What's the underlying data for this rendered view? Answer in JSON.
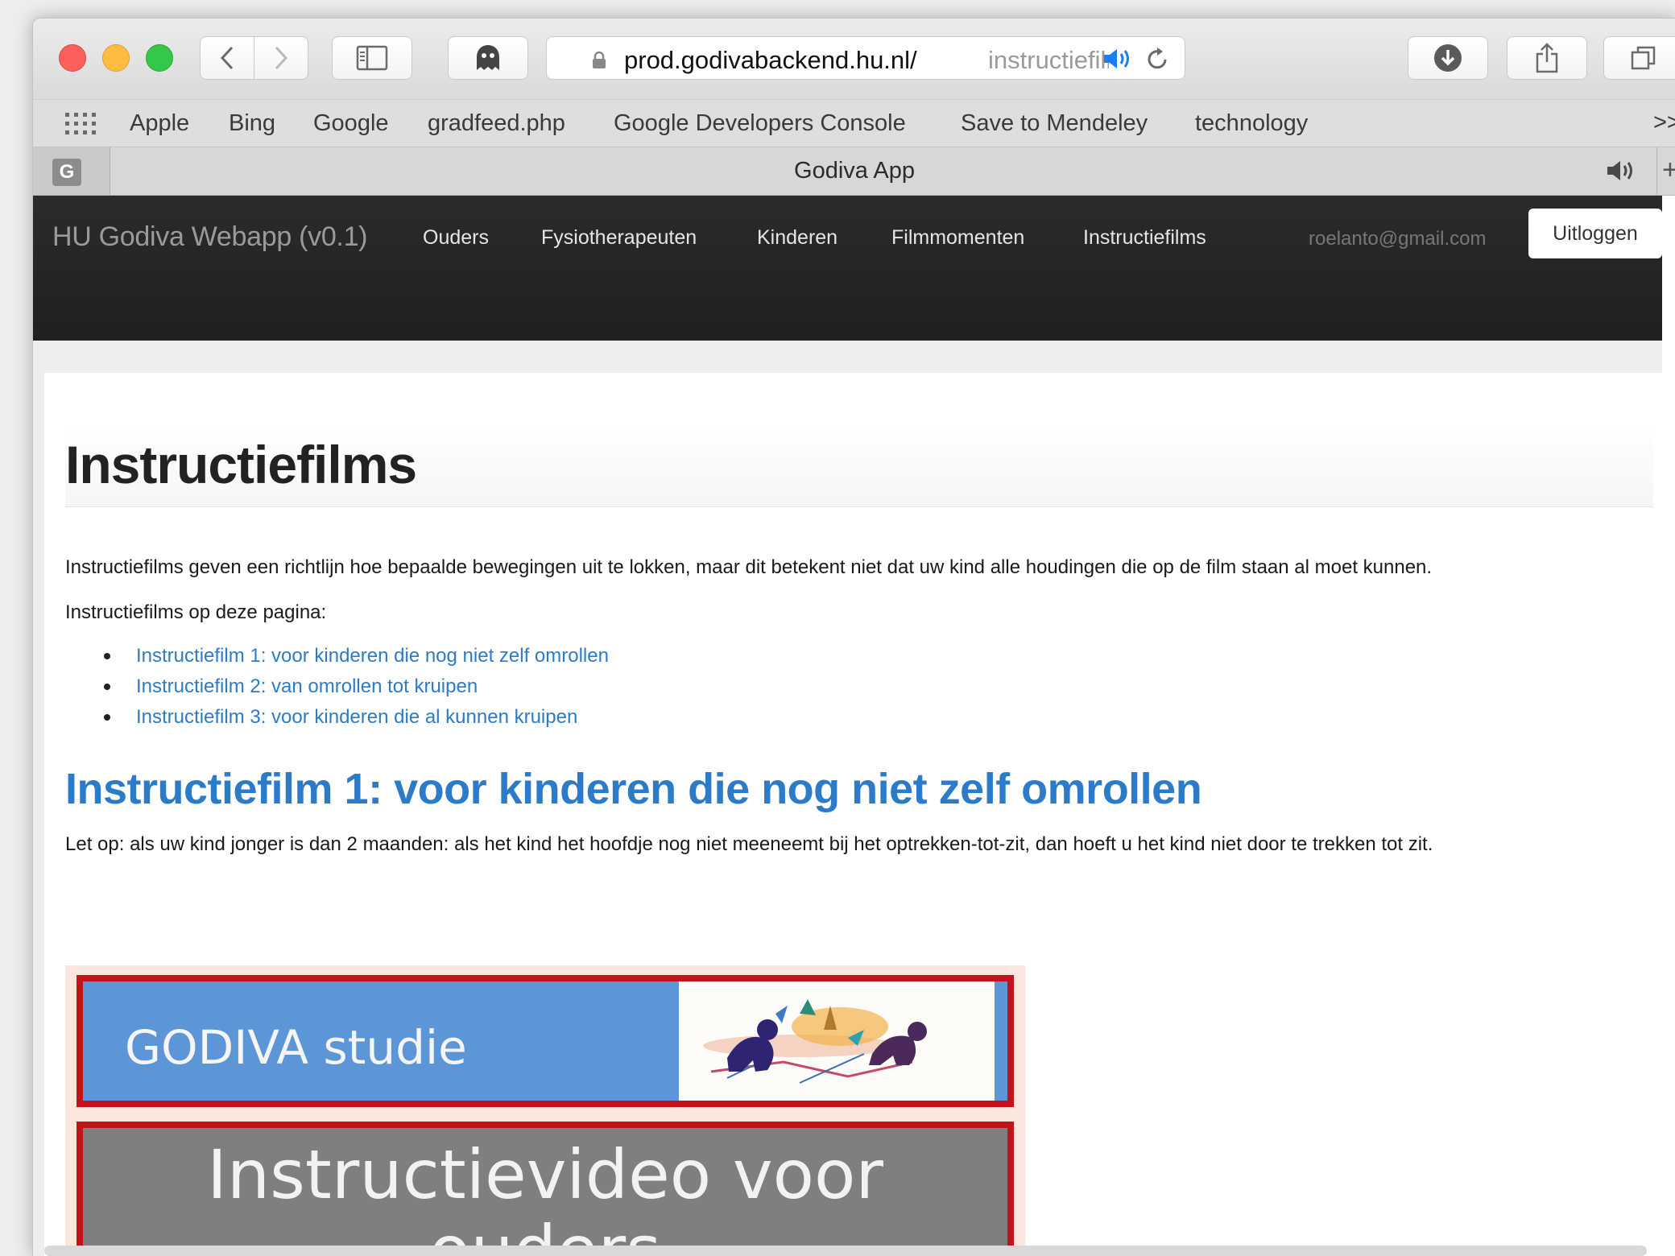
{
  "browser": {
    "url_host": "prod.godivabackend.hu.nl/",
    "url_path": "instructiefilms",
    "tab_title": "Godiva App",
    "favicon_letter": "G",
    "bookmarks": [
      "Apple",
      "Bing",
      "Google",
      "gradfeed.php",
      "Google Developers Console",
      "Save to Mendeley",
      "technology"
    ],
    "bookmarks_overflow": ">>"
  },
  "navbar": {
    "brand": "HU Godiva Webapp (v0.1)",
    "items": [
      "Ouders",
      "Fysiotherapeuten",
      "Kinderen",
      "Filmmomenten",
      "Instructiefilms"
    ],
    "email": "roelanto@gmail.com",
    "logout_label": "Uitloggen"
  },
  "page": {
    "title": "Instructiefilms",
    "intro": "Instructiefilms geven een richtlijn hoe bepaalde bewegingen uit te lokken, maar dit betekent niet dat uw kind alle houdingen die op de film staan al moet kunnen.",
    "list_heading": "Instructiefilms op deze pagina:",
    "links": [
      "Instructiefilm 1: voor kinderen die nog niet zelf omrollen",
      "Instructiefilm 2: van omrollen tot kruipen",
      "Instructiefilm 3: voor kinderen die al kunnen kruipen"
    ],
    "section1_title": "Instructiefilm 1: voor kinderen die nog niet zelf omrollen",
    "section1_note": "Let op: als uw kind jonger is dan 2 maanden: als het kind het hoofdje nog niet meeneemt bij het optrekken-tot-zit, dan hoeft u het kind niet door te trekken tot zit.",
    "video": {
      "banner": "GODIVA studie",
      "title_line1": "Instructievideo voor",
      "title_line2": "ouders"
    }
  },
  "colors": {
    "navbar_bg": "#222222",
    "link": "#2c7bc9",
    "banner_blue": "#5d96d6",
    "banner_border": "#c0141a"
  }
}
